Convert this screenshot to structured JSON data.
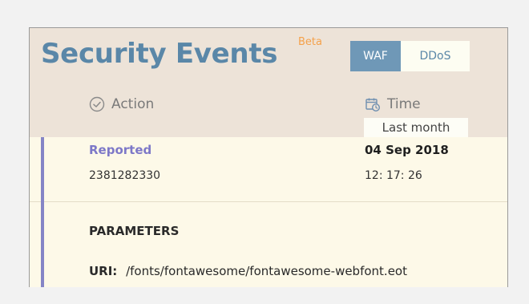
{
  "header": {
    "title": "Security Events",
    "badge": "Beta",
    "tabs": [
      {
        "label": "WAF",
        "active": true
      },
      {
        "label": "DDoS",
        "active": false
      }
    ]
  },
  "columns": {
    "action": {
      "label": "Action",
      "icon": "check-circle-icon"
    },
    "time": {
      "label": "Time",
      "icon": "calendar-clock-icon",
      "filter": "Last month"
    }
  },
  "event": {
    "status": "Reported",
    "id": "2381282330",
    "date": "04 Sep 2018",
    "time": "12: 17: 26"
  },
  "parameters": {
    "title": "PARAMETERS",
    "uri_label": "URI:",
    "uri_value": "/fonts/fontawesome/fontawesome-webfont.eot"
  },
  "colors": {
    "title": "#5a87a8",
    "badge": "#f5a14a",
    "active_tab": "#6f98b7",
    "accent": "#8585c6",
    "status": "#7d78c8",
    "panel_bg": "#ede3d8",
    "row_bg": "#fdf9e8"
  }
}
